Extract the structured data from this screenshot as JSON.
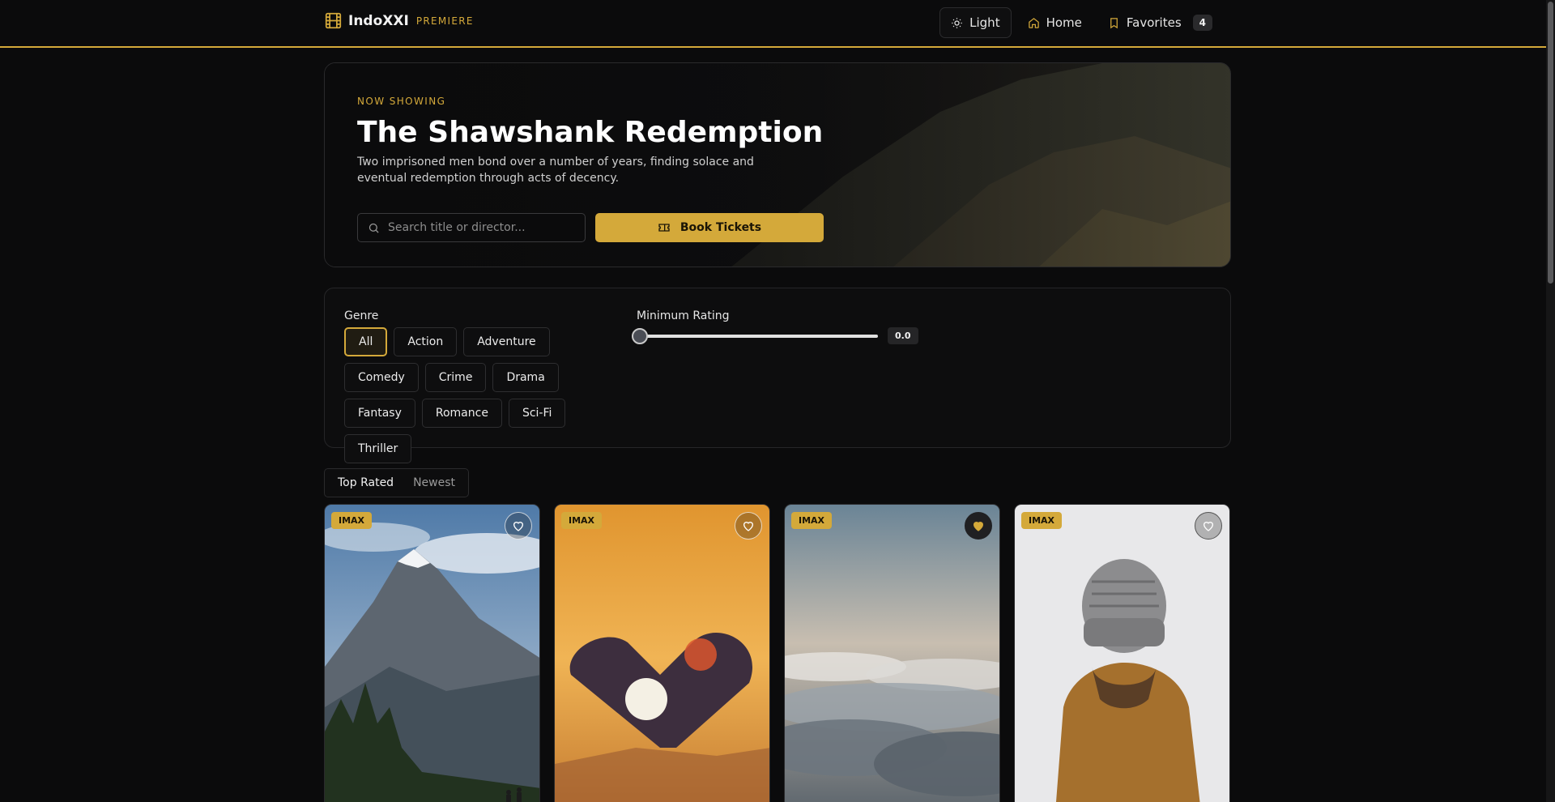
{
  "header": {
    "brand": "IndoXXI",
    "tagline": "PREMIERE",
    "theme_label": "Light",
    "home_label": "Home",
    "favorites_label": "Favorites",
    "favorites_count": "4"
  },
  "hero": {
    "eyebrow": "NOW SHOWING",
    "title": "The Shawshank Redemption",
    "description": "Two imprisoned men bond over a number of years, finding solace and eventual redemption through acts of decency.",
    "search_placeholder": "Search title or director...",
    "book_label": "Book Tickets"
  },
  "filters": {
    "genre_label": "Genre",
    "genres": [
      "All",
      "Action",
      "Adventure",
      "Comedy",
      "Crime",
      "Drama",
      "Fantasy",
      "Romance",
      "Sci-Fi",
      "Thriller"
    ],
    "active_genre": "All",
    "rating_label": "Minimum Rating",
    "rating_value": "0.0"
  },
  "sort": {
    "tabs": [
      "Top Rated",
      "Newest"
    ],
    "active": "Top Rated"
  },
  "movies": [
    {
      "badge": "IMAX",
      "favorited": false,
      "poster": "mountain-hikers"
    },
    {
      "badge": "IMAX",
      "favorited": false,
      "poster": "heart-hands-sunset"
    },
    {
      "badge": "IMAX",
      "favorited": true,
      "poster": "sea-of-clouds"
    },
    {
      "badge": "IMAX",
      "favorited": false,
      "poster": "person-beanie-hoodie"
    }
  ],
  "colors": {
    "accent": "#d4a93a",
    "background": "#0b0b0c"
  }
}
